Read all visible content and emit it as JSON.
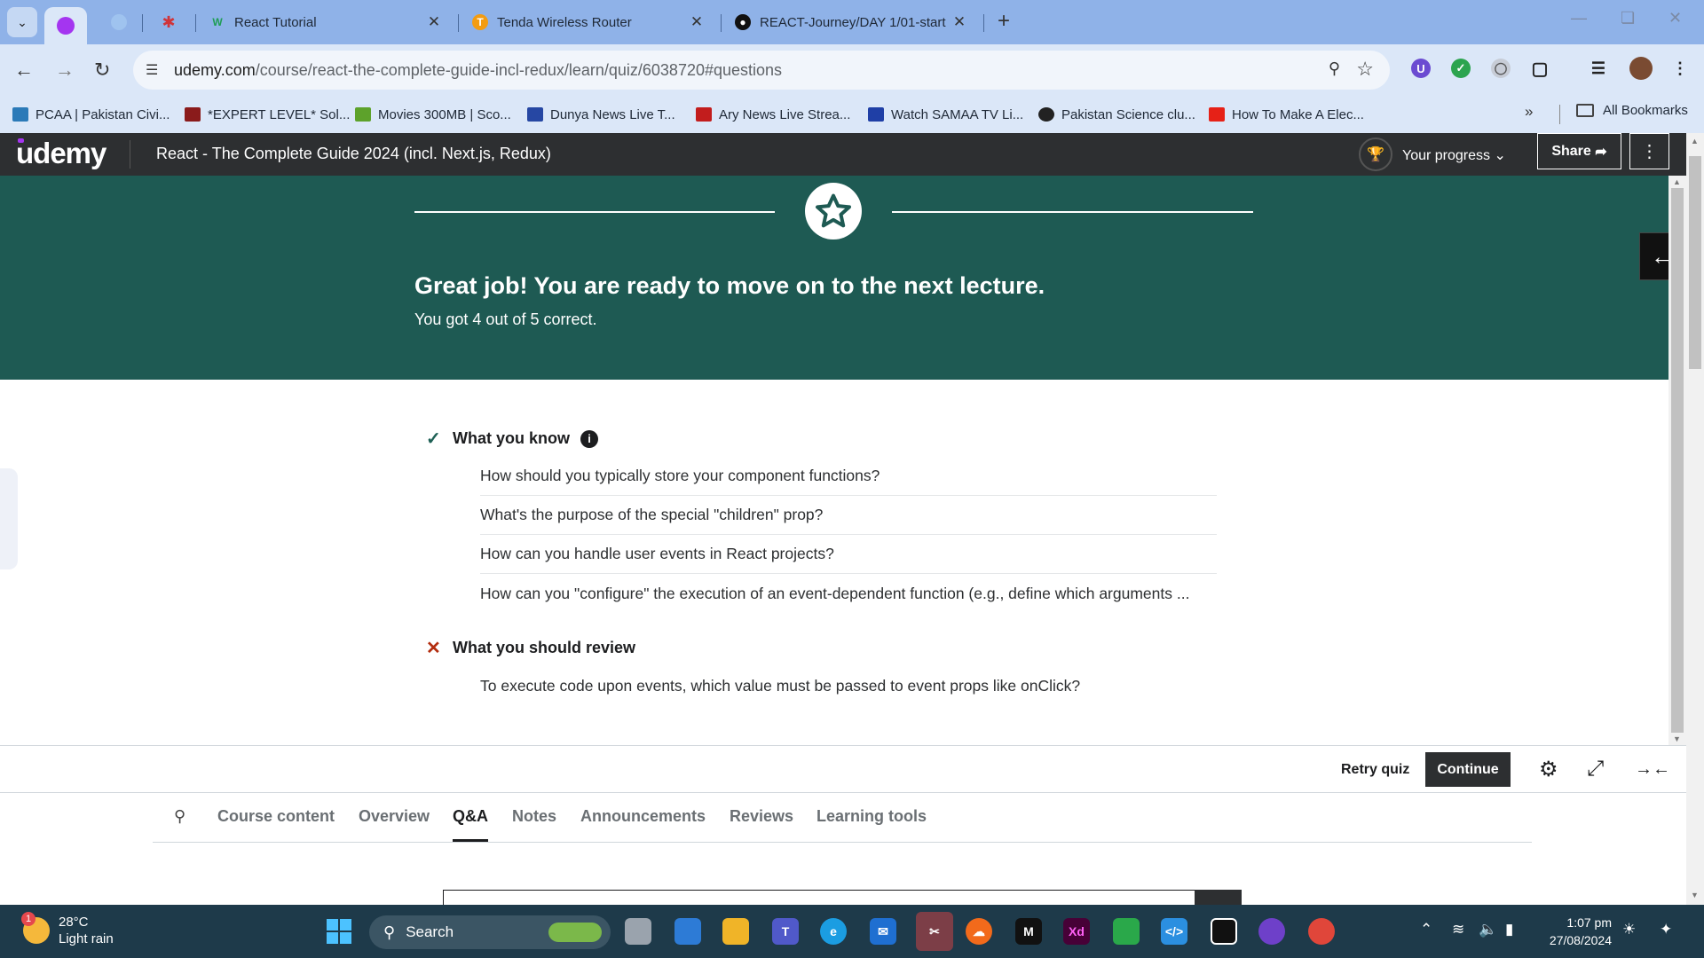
{
  "browser": {
    "tabs": [
      {
        "title": "React Tutorial",
        "favicon": "W",
        "color": "#1f9d55"
      },
      {
        "title": "Tenda Wireless Router",
        "favicon": "T",
        "color": "#f39c12"
      },
      {
        "title": "REACT-Journey/DAY 1/01-start",
        "favicon": "github-icon",
        "color": "#111111"
      }
    ],
    "url_host": "udemy.com",
    "url_path": "/course/react-the-complete-guide-incl-redux/learn/quiz/6038720#questions",
    "bookmarks": [
      "PCAA | Pakistan Civi...",
      "*EXPERT LEVEL* Sol...",
      "Movies 300MB | Sco...",
      "Dunya News Live T...",
      "Ary News Live Strea...",
      "Watch SAMAA TV Li...",
      "Pakistan Science clu...",
      "How To Make A Elec..."
    ],
    "all_bookmarks": "All Bookmarks"
  },
  "header": {
    "logo": "udemy",
    "course_title": "React - The Complete Guide 2024 (incl. Next.js, Redux)",
    "progress_label": "Your progress",
    "share_label": "Share"
  },
  "result": {
    "heading": "Great job! You are ready to move on to the next lecture.",
    "score_text": "You got 4 out of 5 correct."
  },
  "know": {
    "title": "What you know",
    "items": [
      "How should you typically store your component functions?",
      "What's the purpose of the special \"children\" prop?",
      "How can you handle user events in React projects?",
      "How can you \"configure\" the execution of an event-dependent function (e.g., define which arguments ..."
    ]
  },
  "review": {
    "title": "What you should review",
    "items": [
      "To execute code upon events, which value must be passed to event props like onClick?"
    ]
  },
  "footer": {
    "retry_label": "Retry quiz",
    "continue_label": "Continue"
  },
  "course_tabs": [
    "Course content",
    "Overview",
    "Q&A",
    "Notes",
    "Announcements",
    "Reviews",
    "Learning tools"
  ],
  "active_tab": "Q&A",
  "taskbar": {
    "temperature": "28°C",
    "weather": "Light rain",
    "weather_badge": "1",
    "search_label": "Search",
    "time": "1:07 pm",
    "date": "27/08/2024"
  },
  "colors": {
    "banner": "#1e5a53",
    "udemy_header": "#2d2f31",
    "check": "#1e6055",
    "cross": "#b32d0f"
  }
}
